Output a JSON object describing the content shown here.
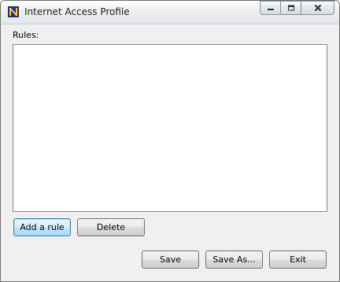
{
  "window": {
    "title": "Internet Access Profile",
    "icon": "app-logo-icon"
  },
  "caption": {
    "minimize_icon": "minimize-icon",
    "maximize_icon": "restore-icon",
    "close_icon": "close-icon"
  },
  "rules": {
    "label": "Rules:",
    "items": []
  },
  "buttons": {
    "add_rule": "Add a rule",
    "delete": "Delete",
    "save": "Save",
    "save_as": "Save As...",
    "exit": "Exit"
  },
  "colors": {
    "accent": "#3c7fb1",
    "window_bg": "#f0f0f0"
  }
}
